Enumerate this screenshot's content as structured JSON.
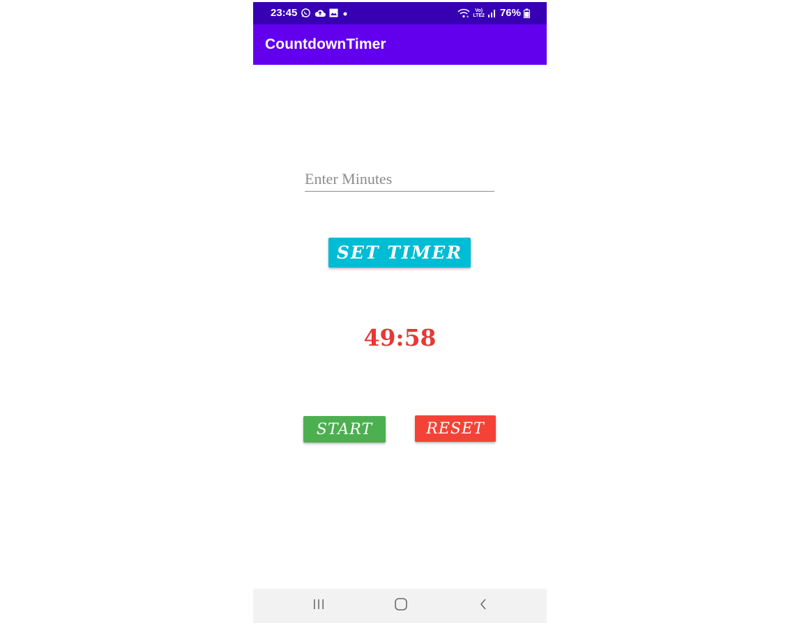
{
  "status_bar": {
    "time": "23:45",
    "battery_percent": "76%",
    "left_icons": [
      "whatsapp-icon",
      "cloud-upload-icon",
      "image-icon",
      "dot-icon"
    ],
    "right_icons": [
      "wifi-icon",
      "volte-lte2-icon",
      "signal-icon",
      "battery-icon"
    ],
    "network_label_top": "Vo)",
    "network_label_bottom": "LTE2"
  },
  "app_bar": {
    "title": "CountdownTimer",
    "color": "#6200ee",
    "status_color": "#3700b3"
  },
  "minutes_input": {
    "placeholder": "Enter Minutes",
    "value": ""
  },
  "set_timer_button": {
    "label": "SET TIMER",
    "color": "#00bcd4"
  },
  "timer": {
    "display": "49:58",
    "color": "#e53935"
  },
  "start_button": {
    "label": "START",
    "color": "#4caf50"
  },
  "reset_button": {
    "label": "RESET",
    "color": "#f44336"
  },
  "nav_bar": {
    "icons": [
      "recents-icon",
      "home-icon",
      "back-icon"
    ]
  }
}
